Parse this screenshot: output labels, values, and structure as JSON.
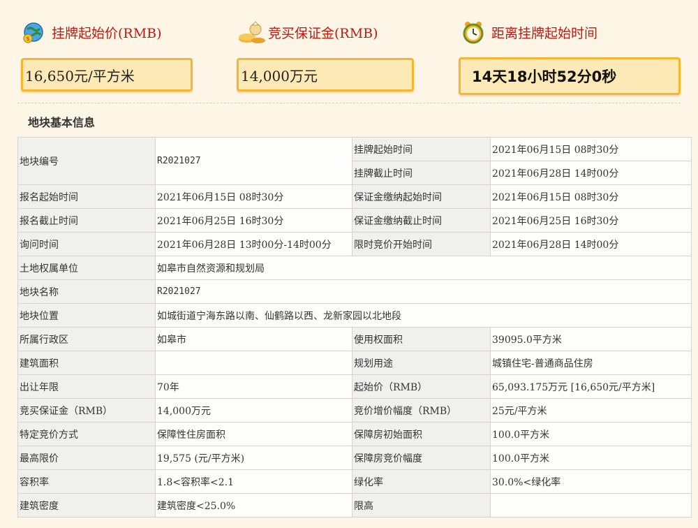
{
  "header": {
    "start_price_label": "挂牌起始价(RMB)",
    "deposit_label": "竞买保证金(RMB)",
    "countdown_label": "距离挂牌起始时间"
  },
  "summary": {
    "start_price": "16,650元/平方米",
    "deposit": "14,000万元",
    "countdown": "14天18小时52分0秒"
  },
  "section_title": "地块基本信息",
  "table": {
    "r1": {
      "k1": "地块编号",
      "v1": "R2021027",
      "k2a": "挂牌起始时间",
      "v2a": "2021年06月15日 08时30分",
      "k2b": "挂牌截止时间",
      "v2b": "2021年06月28日 14时00分"
    },
    "r2": {
      "k1": "报名起始时间",
      "v1": "2021年06月15日 08时30分",
      "k2": "保证金缴纳起始时间",
      "v2": "2021年06月15日 08时30分"
    },
    "r3": {
      "k1": "报名截止时间",
      "v1": "2021年06月25日 16时30分",
      "k2": "保证金缴纳截止时间",
      "v2": "2021年06月25日 16时30分"
    },
    "r4": {
      "k1": "询问时间",
      "v1": "2021年06月28日 13时00分-14时00分",
      "k2": "限时竞价开始时间",
      "v2": "2021年06月28日 14时00分"
    },
    "r5": {
      "k1": "土地权属单位",
      "v1": "如皋市自然资源和规划局"
    },
    "r6": {
      "k1": "地块名称",
      "v1": "R2021027"
    },
    "r7": {
      "k1": "地块位置",
      "v1": "如城街道宁海东路以南、仙鹤路以西、龙新家园以北地段"
    },
    "r8": {
      "k1": "所属行政区",
      "v1": "如皋市",
      "k2": "使用权面积",
      "v2": "39095.0平方米"
    },
    "r9": {
      "k1": "建筑面积",
      "v1": "",
      "k2": "规划用途",
      "v2": "城镇住宅-普通商品住房"
    },
    "r10": {
      "k1": "出让年限",
      "v1": "70年",
      "k2": "起始价（RMB）",
      "v2": "65,093.175万元 [16,650元/平方米]"
    },
    "r11": {
      "k1": "竞买保证金（RMB）",
      "v1": "14,000万元",
      "k2": "竞价增价幅度（RMB）",
      "v2": "25元/平方米"
    },
    "r12": {
      "k1": "特定竞价方式",
      "v1": "保障性住房面积",
      "k2": "保障房初始面积",
      "v2": "100.0平方米"
    },
    "r13": {
      "k1": "最高限价",
      "v1": "19,575 (元/平方米)",
      "k2": "保障房竞价幅度",
      "v2": "100.0平方米"
    },
    "r14": {
      "k1": "容积率",
      "v1": "1.8<容积率<2.1",
      "k2": "绿化率",
      "v2": "30.0%<绿化率"
    },
    "r15": {
      "k1": "建筑密度",
      "v1": "建筑密度<25.0%",
      "k2": "限高",
      "v2": ""
    }
  },
  "icons": {
    "price": "globe-coin-icon",
    "deposit": "money-bag-icon",
    "timer": "alarm-clock-icon"
  },
  "colors": {
    "label_red": "#c0180f",
    "box_border": "#f6b632",
    "box_fill": "#fde9b5",
    "page_bg": "#fdf6e6"
  }
}
